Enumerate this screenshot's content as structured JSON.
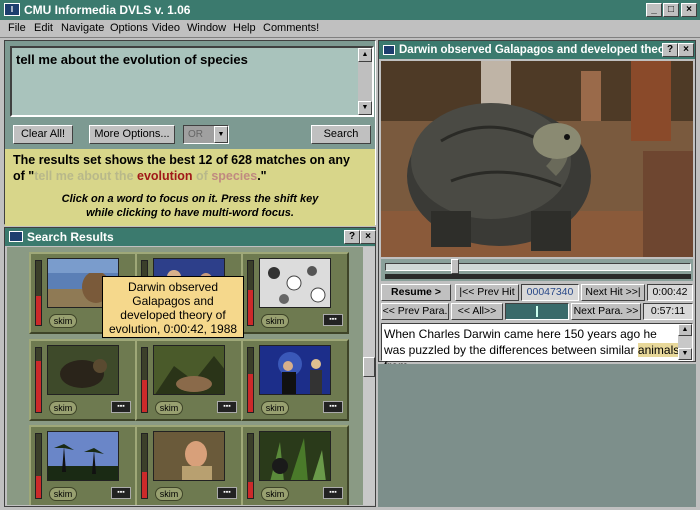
{
  "app": {
    "title": "CMU Informedia DVLS  v. 1.06",
    "icon_label": "I",
    "controls": [
      "_",
      "□",
      "×"
    ]
  },
  "menu": [
    "File",
    "Edit",
    "Navigate",
    "Options",
    "Video",
    "Window",
    "Help",
    "Comments!"
  ],
  "query": {
    "text": "tell me about the evolution of species",
    "buttons": {
      "clear": "Clear All!",
      "more": "More Options...",
      "search": "Search"
    },
    "operator": "OR"
  },
  "results_message": {
    "line1": "The results set shows the best 12 of 628 matches on any",
    "line2_prefix": "of \"",
    "words": [
      {
        "text": "tell me about the",
        "style": "dim"
      },
      {
        "text": " evolution",
        "style": "red"
      },
      {
        "text": " of",
        "style": "dim"
      },
      {
        "text": " species",
        "style": "red-dim"
      }
    ],
    "line2_suffix": ".\"",
    "hint1": "Click on a word to focus on it.  Press the shift key",
    "hint2": "while clicking to have multi-word focus."
  },
  "search_results": {
    "title": "Search Results",
    "help": "?",
    "close": "×",
    "skim_label": "skim",
    "film_label": "▪▪▪",
    "relevance": [
      0.45,
      0.3,
      0.55,
      0.8,
      0.5,
      0.6,
      0.35,
      0.4,
      0.25
    ],
    "tooltip": [
      "Darwin observed",
      "Galapagos and",
      "developed theory of",
      "evolution, 0:00:42, 1988"
    ]
  },
  "video": {
    "title": "Darwin observed Galapagos and developed theor...",
    "help": "?",
    "close": "×",
    "position_fraction": 0.22,
    "controls_row1": {
      "resume": "Resume  >",
      "prev_hit": "|<< Prev Hit",
      "frame": "00047340",
      "next_hit": "Next Hit >>|",
      "time": "0:00:42"
    },
    "controls_row2": {
      "prev_para": "<< Prev Para.",
      "all": "<< All>>",
      "next_para": "Next Para. >>",
      "time": "0:57:11"
    },
    "transcript_before": "When Charles Darwin came here 150 years ago he was puzzled by the differences between similar ",
    "transcript_highlight": "animals",
    "transcript_after": " from"
  }
}
